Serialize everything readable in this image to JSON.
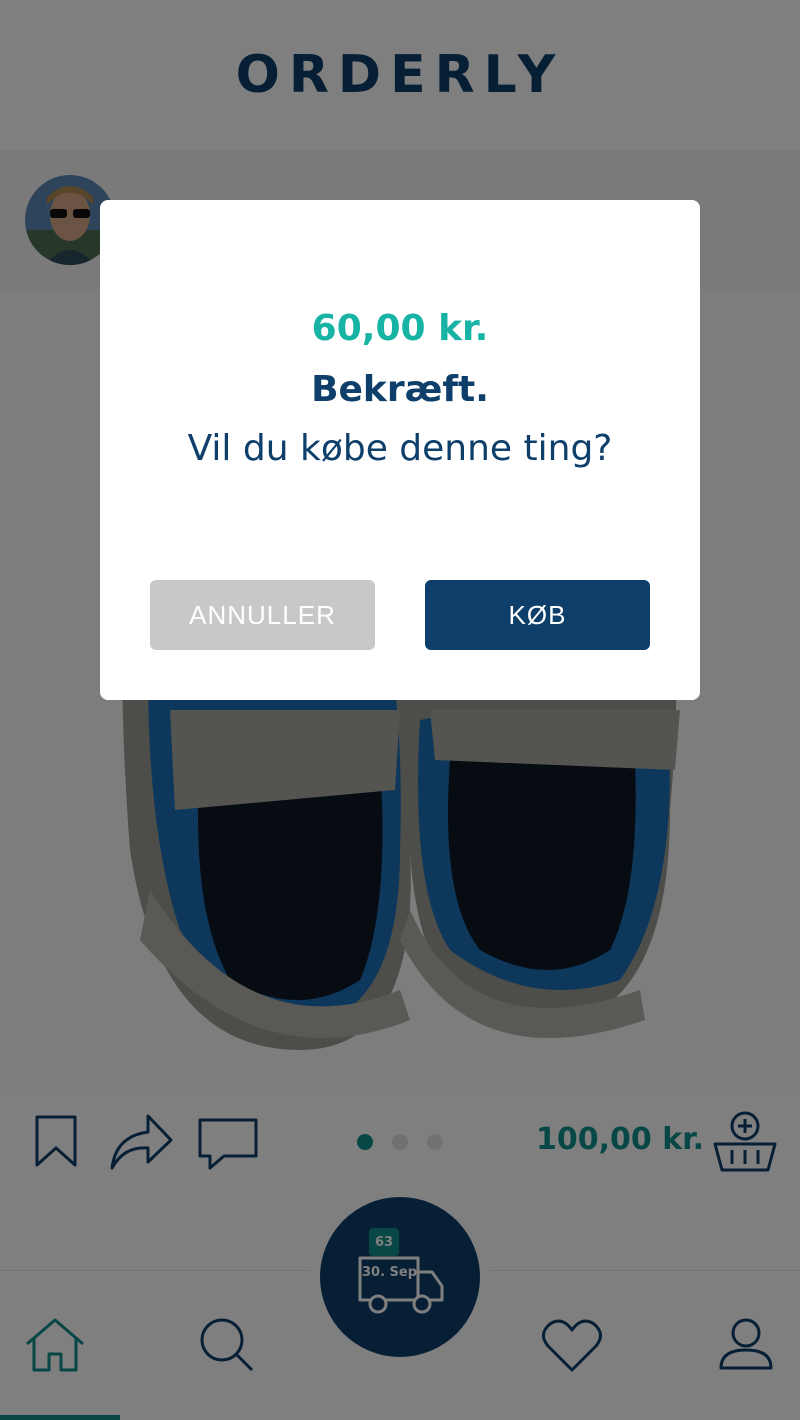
{
  "app": {
    "logo": "ORDERLY"
  },
  "seller": {
    "avatar_icon": "user-avatar"
  },
  "listing": {
    "price": "100,00 kr.",
    "dots": 3,
    "active_dot": 1,
    "actions": [
      "bookmark-icon",
      "share-icon",
      "comment-icon",
      "add-to-basket-icon"
    ]
  },
  "delivery": {
    "count": "63",
    "date": "30. Sep"
  },
  "nav": {
    "items": [
      "home-icon",
      "search-icon",
      "truck-icon",
      "heart-icon",
      "profile-icon"
    ],
    "active": "home"
  },
  "modal": {
    "price": "60,00 kr.",
    "title": "Bekræft.",
    "message": "Vil du købe denne ting?",
    "cancel_label": "ANNULLER",
    "buy_label": "KØB"
  },
  "colors": {
    "navy": "#0e3f6b",
    "teal": "#0f8f8c",
    "modal_teal": "#17b3a5",
    "cancel_gray": "#c8c8c8"
  }
}
